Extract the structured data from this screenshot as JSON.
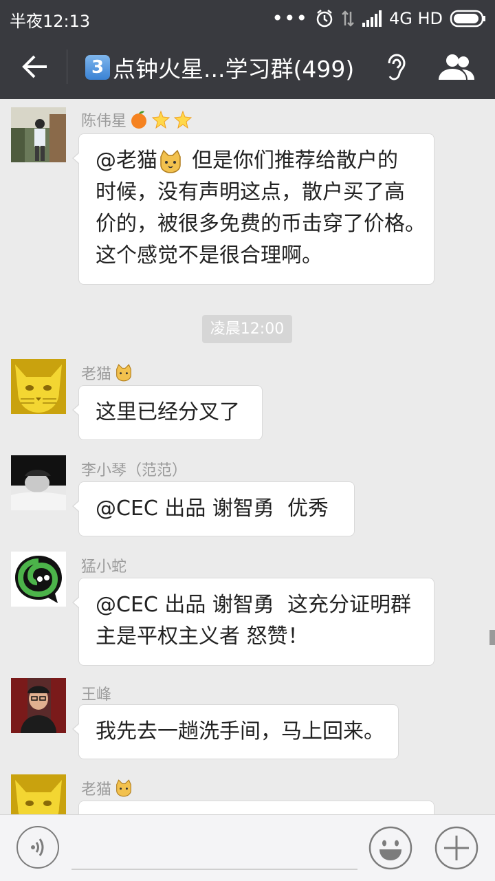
{
  "status_bar": {
    "time": "半夜12:13",
    "network": "4G HD"
  },
  "header": {
    "badge": "3",
    "title": "点钟火星...学习群(499)"
  },
  "messages": [
    {
      "sender": "陈伟星",
      "text_lines": [
        "@老猫",
        "但是你们推荐给散户的",
        "时候，没有声明这点，散户买了高",
        "价的，被很多免费的币击穿了价格。",
        "这个感觉不是很合理啊。"
      ]
    },
    {
      "sender": "老猫",
      "text": "这里已经分叉了"
    },
    {
      "sender": "李小琴（范范）",
      "text": "@CEC 出品 谢智勇  优秀"
    },
    {
      "sender": "猛小蛇",
      "text_lines": [
        "@CEC 出品 谢智勇  这充分证明群",
        "主是平权主义者 怒赞！"
      ]
    },
    {
      "sender": "王峰",
      "text": "我先去一趟洗手间，马上回来。"
    },
    {
      "sender": "老猫",
      "text": ""
    }
  ],
  "timestamp": "凌晨12:00",
  "colors": {
    "header_bg": "#393a3f",
    "chat_bg": "#ebebeb",
    "bubble_bg": "#ffffff",
    "sender_text": "#9b9b9b",
    "avatar_cat": "#d4ad16"
  },
  "icons": {
    "back": "back-arrow-icon",
    "ear": "ear-icon",
    "group": "group-people-icon",
    "voice": "voice-icon",
    "emoji": "smiley-icon",
    "plus": "plus-icon"
  }
}
